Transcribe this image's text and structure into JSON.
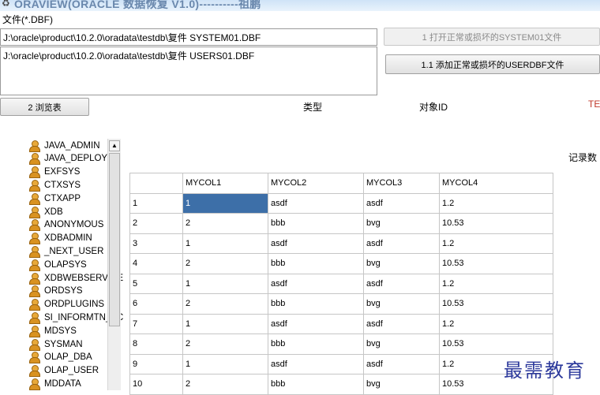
{
  "window": {
    "title": "ORAVIEW(ORACLE 数据恢复 V1.0)----------祖鹏"
  },
  "file_section": {
    "label": "文件(*.DBF)",
    "system_path": "J:\\oracle\\product\\10.2.0\\oradata\\testdb\\复件 SYSTEM01.DBF",
    "users_path": "J:\\oracle\\product\\10.2.0\\oradata\\testdb\\复件 USERS01.DBF",
    "open_system_button": "1 打开正常或损坏的SYSTEM01文件",
    "add_userdbf_button": "1.1 添加正常或损坏的USERDBF文件"
  },
  "toolbar": {
    "browse_button": "2 浏览表",
    "type_label": "类型",
    "object_id_label": "对象ID",
    "te_label": "TE",
    "record_count_label": "记录数"
  },
  "tree": {
    "items": [
      "JAVA_ADMIN",
      "JAVA_DEPLOY",
      "EXFSYS",
      "CTXSYS",
      "CTXAPP",
      "XDB",
      "ANONYMOUS",
      "XDBADMIN",
      "_NEXT_USER",
      "OLAPSYS",
      "XDBWEBSERVICES",
      "ORDSYS",
      "ORDPLUGINS",
      "SI_INFORMTN_SCHEMA",
      "MDSYS",
      "SYSMAN",
      "OLAP_DBA",
      "OLAP_USER",
      "MDDATA"
    ]
  },
  "grid": {
    "columns": [
      "MYCOL1",
      "MYCOL2",
      "MYCOL3",
      "MYCOL4"
    ],
    "rows": [
      [
        "1",
        "1",
        "asdf",
        "asdf",
        "1.2"
      ],
      [
        "2",
        "2",
        "bbb",
        "bvg",
        "10.53"
      ],
      [
        "3",
        "1",
        "asdf",
        "asdf",
        "1.2"
      ],
      [
        "4",
        "2",
        "bbb",
        "bvg",
        "10.53"
      ],
      [
        "5",
        "1",
        "asdf",
        "asdf",
        "1.2"
      ],
      [
        "6",
        "2",
        "bbb",
        "bvg",
        "10.53"
      ],
      [
        "7",
        "1",
        "asdf",
        "asdf",
        "1.2"
      ],
      [
        "8",
        "2",
        "bbb",
        "bvg",
        "10.53"
      ],
      [
        "9",
        "1",
        "asdf",
        "asdf",
        "1.2"
      ],
      [
        "10",
        "2",
        "bbb",
        "bvg",
        "10.53"
      ]
    ]
  },
  "watermark": "最需教育"
}
